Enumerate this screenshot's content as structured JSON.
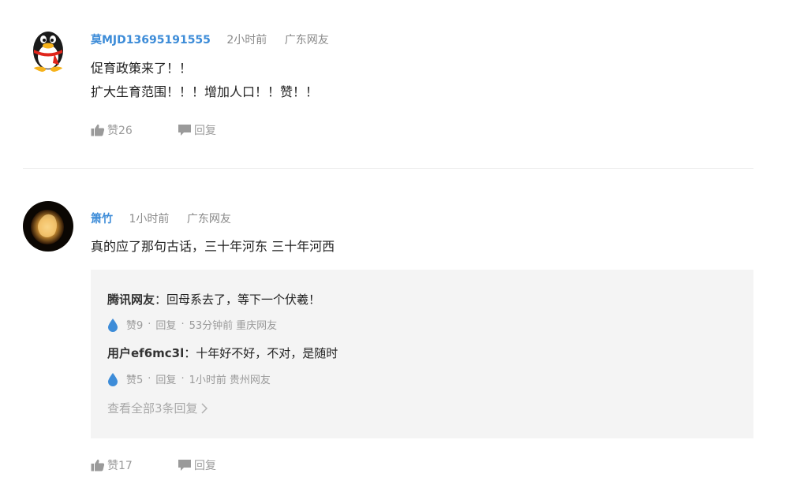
{
  "comments": [
    {
      "username": "莫MJD13695191555",
      "time": "2小时前",
      "location": "广东网友",
      "lines": [
        "促育政策来了！！",
        "扩大生育范围！！！增加人口！！赞！！"
      ],
      "like_label": "赞26",
      "reply_label": "回复",
      "avatar": "penguin-avatar"
    },
    {
      "username": "箫竹",
      "time": "1小时前",
      "location": "广东网友",
      "lines": [
        "真的应了那句古话，三十年河东 三十年河西"
      ],
      "like_label": "赞17",
      "reply_label": "回复",
      "avatar": "lamp-photo-avatar",
      "replies": [
        {
          "user": "腾讯网友",
          "text": "：回母系去了，等下一个伏羲！",
          "likes": "赞9",
          "reply": "回复",
          "time": "53分钟前",
          "location": "重庆网友"
        },
        {
          "user": "用户ef6mc3l",
          "text": "：十年好不好，不对，是随时",
          "likes": "赞5",
          "reply": "回复",
          "time": "1小时前",
          "location": "贵州网友"
        }
      ],
      "view_all": "查看全部3条回复"
    }
  ],
  "colors": {
    "username": "#3d8cd8",
    "meta": "#8a8a8a",
    "reply_bg": "#f4f4f4",
    "drop_icon": "#3d8cd8"
  }
}
